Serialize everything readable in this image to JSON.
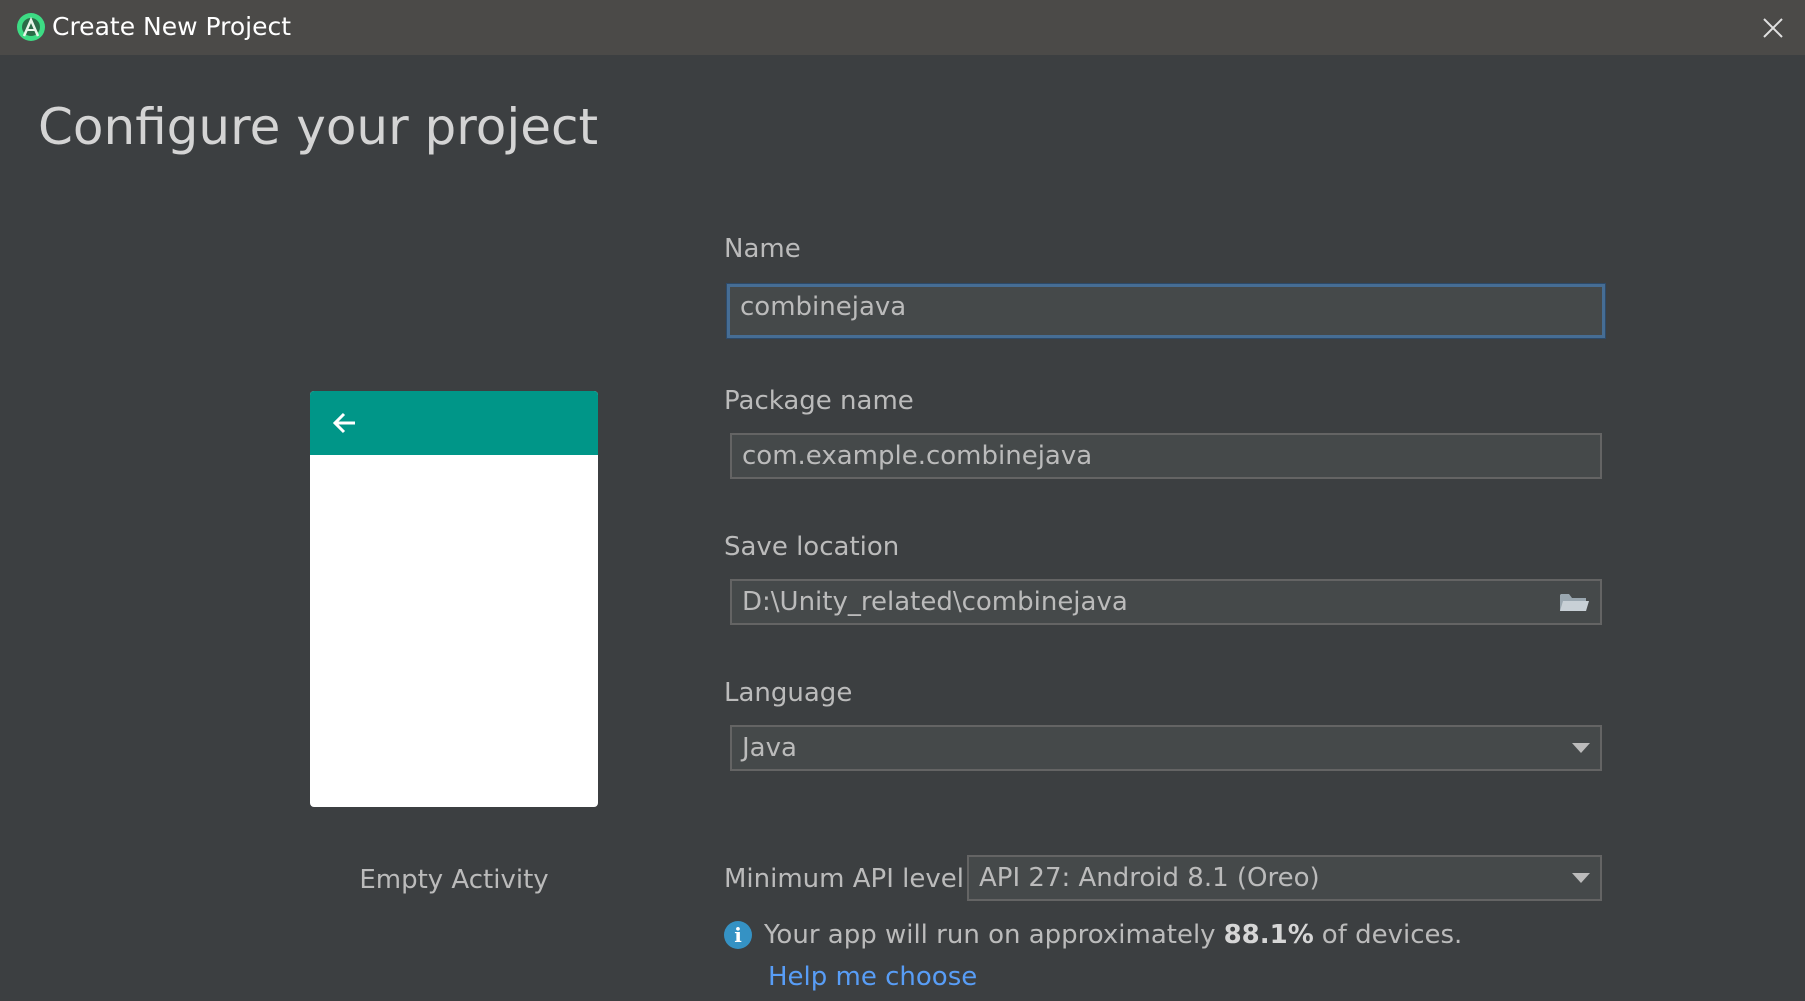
{
  "window": {
    "title": "Create New Project",
    "icon": "android-studio-icon",
    "close_icon": "close-icon"
  },
  "page": {
    "title": "Configure your project"
  },
  "preview": {
    "template_name": "Empty Activity",
    "appbar_color": "#009688",
    "back_icon": "arrow-left-icon"
  },
  "form": {
    "name": {
      "label": "Name",
      "value": "combinejava"
    },
    "package": {
      "label": "Package name",
      "value": "com.example.combinejava"
    },
    "location": {
      "label": "Save location",
      "value": "D:\\Unity_related\\combinejava",
      "icon": "folder-icon"
    },
    "language": {
      "label": "Language",
      "selected": "Java"
    },
    "min_api": {
      "label": "Minimum API level",
      "selected": "API 27: Android 8.1 (Oreo)"
    }
  },
  "info": {
    "icon": "info-icon",
    "prefix": "Your app will run on approximately",
    "percent": "88.1%",
    "suffix": "of devices.",
    "help_link": "Help me choose"
  },
  "colors": {
    "background": "#3c3f41",
    "titlebar": "#4b4a48",
    "focus_border": "#466d94",
    "link": "#589df6"
  }
}
